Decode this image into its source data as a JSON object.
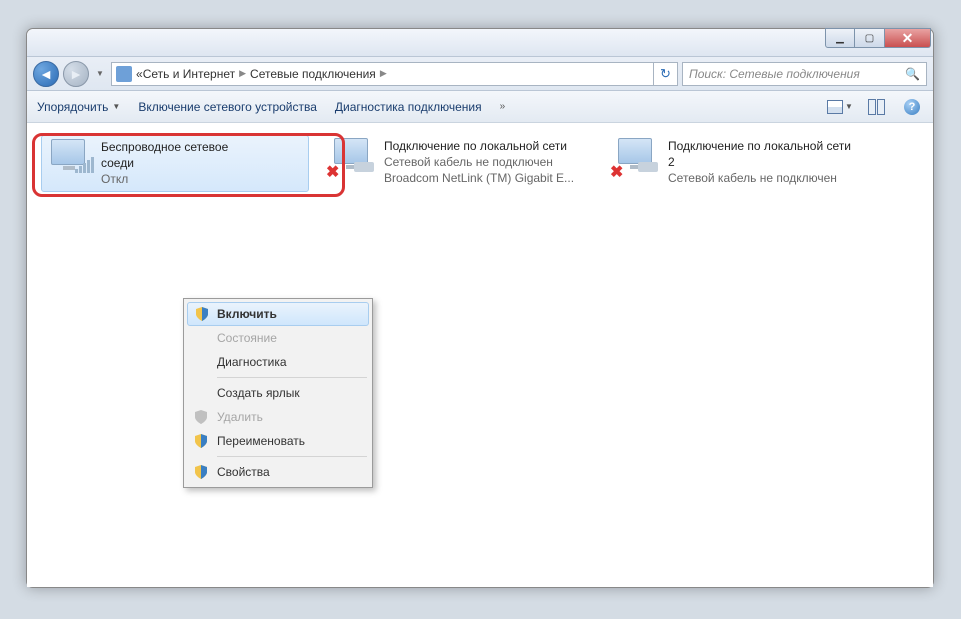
{
  "breadcrumb": {
    "level1": "Сеть и Интернет",
    "level2": "Сетевые подключения"
  },
  "search": {
    "placeholder": "Поиск: Сетевые подключения"
  },
  "toolbar": {
    "organize": "Упорядочить",
    "enable_device": "Включение сетевого устройства",
    "diagnose": "Диагностика подключения",
    "more": "»"
  },
  "items": [
    {
      "title": "Беспроводное сетевое",
      "line2": "соеди",
      "line3": "Откл"
    },
    {
      "title": "Подключение по локальной сети",
      "line2": "Сетевой кабель не подключен",
      "line3": "Broadcom NetLink (TM) Gigabit E..."
    },
    {
      "title": "Подключение по локальной сети",
      "line2": "2",
      "line3": "Сетевой кабель не подключен"
    }
  ],
  "context_menu": {
    "enable": "Включить",
    "status": "Состояние",
    "diagnostics": "Диагностика",
    "shortcut": "Создать ярлык",
    "delete": "Удалить",
    "rename": "Переименовать",
    "properties": "Свойства"
  }
}
